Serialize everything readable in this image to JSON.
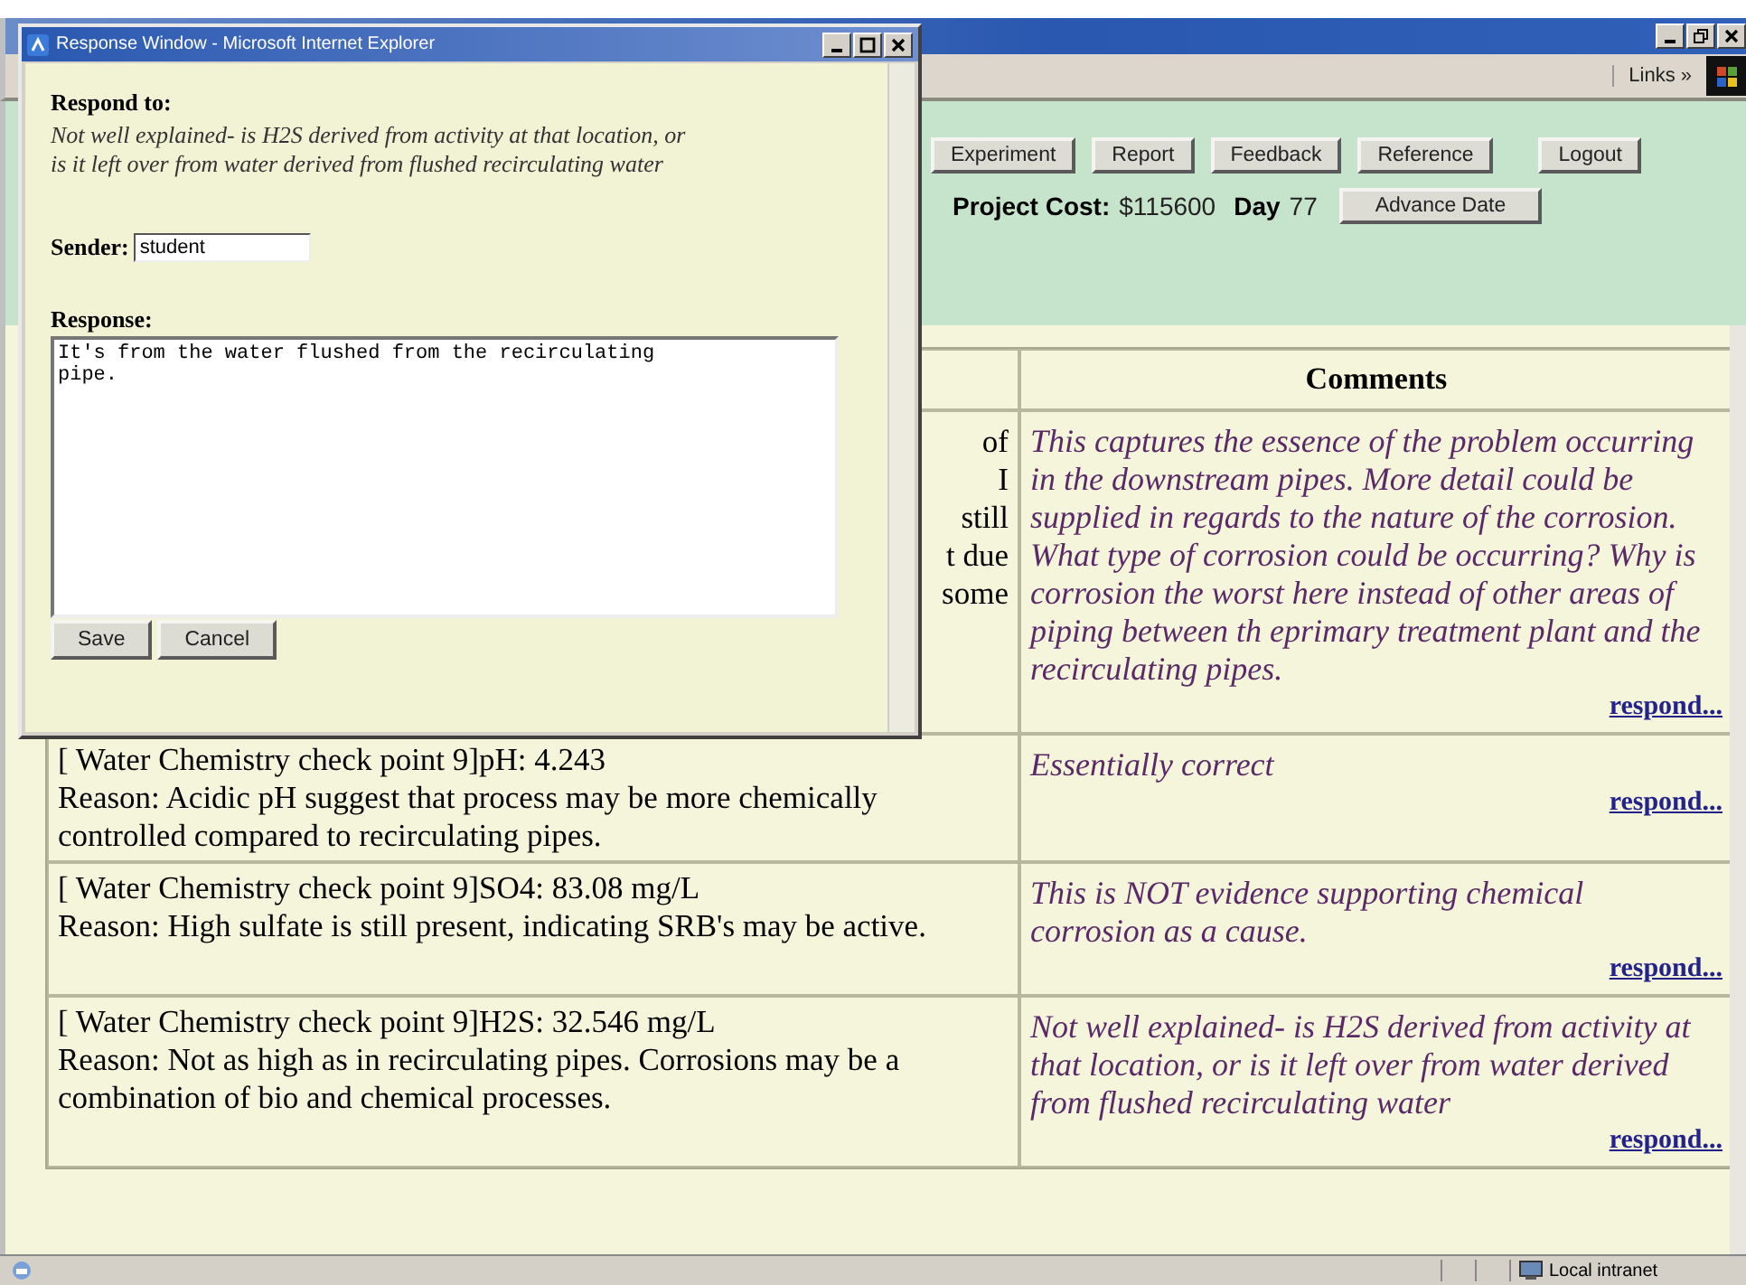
{
  "browser_window": {
    "links_label": "Links »"
  },
  "nav_buttons": [
    "Experiment",
    "Report",
    "Feedback",
    "Reference",
    "Logout"
  ],
  "project": {
    "cost_label": "Project Cost:",
    "cost": "$115600",
    "day_label": "Day",
    "day": "77",
    "advance_button": "Advance Date"
  },
  "table": {
    "comments_heading": "Comments",
    "rows": [
      {
        "kind": "covered",
        "fragments": [
          "of",
          "I",
          "still",
          "t due",
          "some"
        ],
        "comment": "This captures the essence of the problem occurring in the downstream pipes. More detail could be supplied in regards to the nature of the corrosion. What type of corrosion could be occurring? Why is corrosion the worst here instead of other areas of piping between th eprimary treatment plant and the recirculating pipes.",
        "respond": "respond..."
      },
      {
        "kind": "finding",
        "finding": "[ Water Chemistry check point 9]pH: 4.243",
        "reason": "Reason: Acidic pH suggest that process may be more chemically controlled compared to recirculating pipes.",
        "comment": "Essentially correct",
        "respond": "respond..."
      },
      {
        "kind": "finding",
        "finding": "[ Water Chemistry check point 9]SO4: 83.08 mg/L",
        "reason": "Reason: High sulfate is still present, indicating SRB's may be active.",
        "comment": "This is NOT evidence supporting chemical corrosion as a cause.",
        "respond": "respond..."
      },
      {
        "kind": "finding",
        "finding": "[ Water Chemistry check point 9]H2S: 32.546 mg/L",
        "reason": "Reason: Not as high as in recirculating pipes. Corrosions may be a combination of bio and chemical processes.",
        "comment": "Not well explained- is H2S derived from activity at that location, or is it left over from water derived from flushed recirculating water",
        "respond": "respond..."
      }
    ]
  },
  "status_bar": {
    "zone": "Local intranet"
  },
  "popup": {
    "title": "Response Window - Microsoft Internet Explorer",
    "respond_label": "Respond to:",
    "respond_text": "Not well explained- is H2S derived from activity at that location, or is it left over from water derived from flushed recirculating water",
    "sender_label": "Sender:",
    "sender": "student",
    "response_label": "Response:",
    "response": "It's from the water flushed from the recirculating\npipe.",
    "buttons": [
      "Save",
      "Cancel"
    ]
  }
}
